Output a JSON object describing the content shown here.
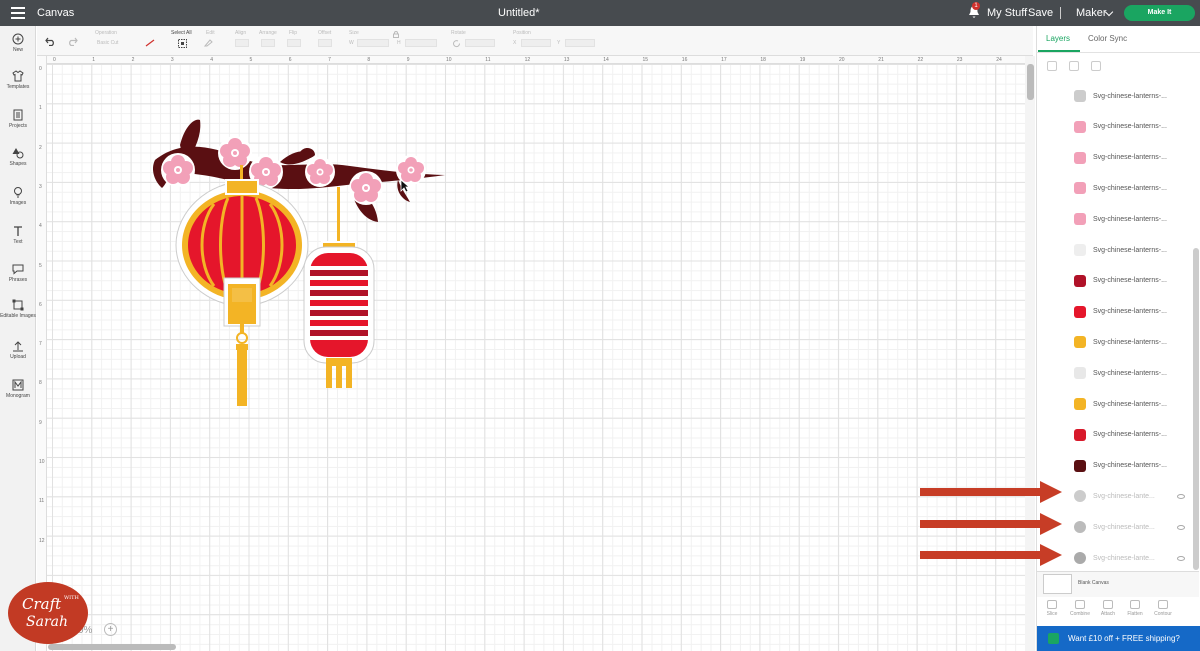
{
  "topbar": {
    "app_title": "Canvas",
    "doc_title": "Untitled*",
    "notification_count": "1",
    "my_stuff": "My Stuff",
    "save": "Save",
    "machine": "Maker",
    "make_it": "Make It"
  },
  "sidebar": {
    "items": [
      {
        "label": "New",
        "icon": "plus-circle-icon"
      },
      {
        "label": "Templates",
        "icon": "shirt-icon"
      },
      {
        "label": "Projects",
        "icon": "projects-icon"
      },
      {
        "label": "Shapes",
        "icon": "shapes-icon"
      },
      {
        "label": "Images",
        "icon": "lightbulb-icon"
      },
      {
        "label": "Text",
        "icon": "text-icon"
      },
      {
        "label": "Phrases",
        "icon": "speech-bubble-icon"
      },
      {
        "label": "Editable Images",
        "icon": "editable-images-icon"
      },
      {
        "label": "Upload",
        "icon": "upload-icon"
      },
      {
        "label": "Monogram",
        "icon": "monogram-icon"
      }
    ]
  },
  "toolbar": {
    "operation_label": "Operation",
    "operation_value": "Basic Cut",
    "select_all": "Select All",
    "edit": "Edit",
    "align": "Align",
    "arrange": "Arrange",
    "flip": "Flip",
    "offset": "Offset",
    "size": "Size",
    "size_w": "W",
    "size_h": "H",
    "rotate": "Rotate",
    "position": "Position",
    "position_x": "X",
    "position_y": "Y"
  },
  "ruler": {
    "h_ticks": [
      "0",
      "1",
      "2",
      "3",
      "4",
      "5",
      "6",
      "7",
      "8",
      "9",
      "10",
      "11",
      "12",
      "13",
      "14",
      "15",
      "16",
      "17",
      "18",
      "19",
      "20",
      "21",
      "22",
      "23",
      "24"
    ],
    "v_ticks": [
      "0",
      "1",
      "2",
      "3",
      "4",
      "5",
      "6",
      "7",
      "8",
      "9",
      "10",
      "11",
      "12"
    ]
  },
  "zoom": {
    "value": "0%"
  },
  "rightpanel": {
    "tab_layers": "Layers",
    "tab_colorsync": "Color Sync",
    "layers": [
      {
        "name": "Svg-chinese-lanterns-...",
        "thumb": "#cccccc",
        "faded": false
      },
      {
        "name": "Svg-chinese-lanterns-...",
        "thumb": "#f2a0b8",
        "faded": false
      },
      {
        "name": "Svg-chinese-lanterns-...",
        "thumb": "#f2a0b8",
        "faded": false
      },
      {
        "name": "Svg-chinese-lanterns-...",
        "thumb": "#f2a0b8",
        "faded": false
      },
      {
        "name": "Svg-chinese-lanterns-...",
        "thumb": "#f2a0b8",
        "faded": false
      },
      {
        "name": "Svg-chinese-lanterns-...",
        "thumb": "#eeeeee",
        "faded": false
      },
      {
        "name": "Svg-chinese-lanterns-...",
        "thumb": "#b01228",
        "faded": false
      },
      {
        "name": "Svg-chinese-lanterns-...",
        "thumb": "#e5162b",
        "faded": false
      },
      {
        "name": "Svg-chinese-lanterns-...",
        "thumb": "#f3b425",
        "faded": false
      },
      {
        "name": "Svg-chinese-lanterns-...",
        "thumb": "#e8e8e8",
        "faded": false
      },
      {
        "name": "Svg-chinese-lanterns-...",
        "thumb": "#f3b425",
        "faded": false
      },
      {
        "name": "Svg-chinese-lanterns-...",
        "thumb": "#d8192b",
        "faded": false
      },
      {
        "name": "Svg-chinese-lanterns-...",
        "thumb": "#5a0f12",
        "faded": false
      },
      {
        "name": "Svg-chinese-lante...",
        "thumb": "#cccccc",
        "faded": true
      },
      {
        "name": "Svg-chinese-lante...",
        "thumb": "#bbbbbb",
        "faded": true
      },
      {
        "name": "Svg-chinese-lante...",
        "thumb": "#aaaaaa",
        "faded": true
      }
    ],
    "blank_canvas": "Blank Canvas",
    "bottom_tools": [
      "Slice",
      "Combine",
      "Attach",
      "Flatten",
      "Contour"
    ],
    "promo": "Want £10 off + FREE shipping?"
  },
  "watermark": {
    "craft": "Craft",
    "with": "WITH",
    "sarah": "Sarah"
  },
  "colors": {
    "accent": "#1aa561",
    "topbar": "#474b4f",
    "arrow": "#c73d26",
    "promo": "#1569c7"
  }
}
